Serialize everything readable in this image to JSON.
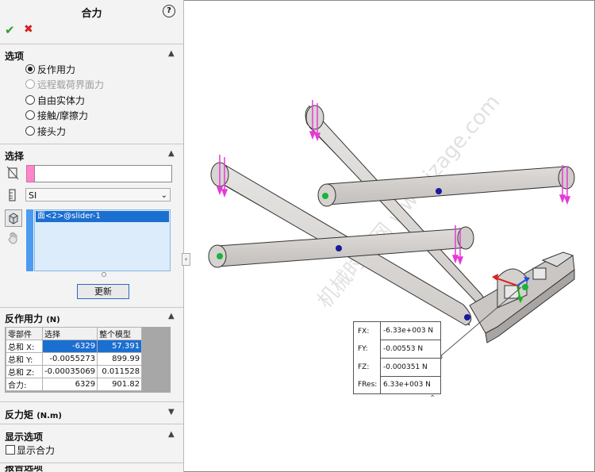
{
  "manager": {
    "title": "合力",
    "help_icon": "?",
    "ok_icon": "✔",
    "cancel_icon": "✖"
  },
  "options": {
    "title": "选项",
    "items": [
      {
        "label": "反作用力",
        "selected": true,
        "enabled": true
      },
      {
        "label": "远程载荷界面力",
        "selected": false,
        "enabled": false
      },
      {
        "label": "自由实体力",
        "selected": false,
        "enabled": true
      },
      {
        "label": "接触/摩擦力",
        "selected": false,
        "enabled": true
      },
      {
        "label": "接头力",
        "selected": false,
        "enabled": true
      }
    ]
  },
  "selection": {
    "title": "选择",
    "input_value": "",
    "units": "SI",
    "list_item": "面<2>@slider-1",
    "update_label": "更新"
  },
  "reaction_force": {
    "title": "反作用力",
    "unit": "(N)",
    "headers": [
      "零部件",
      "选择",
      "整个模型"
    ],
    "rows": [
      [
        "总和 X:",
        "-6329",
        "57.391"
      ],
      [
        "总和 Y:",
        "-0.0055273",
        "899.99"
      ],
      [
        "总和 Z:",
        "-0.00035069",
        "0.011528"
      ],
      [
        "合力:",
        "6329",
        "901.82"
      ]
    ]
  },
  "reaction_moment": {
    "title": "反力矩",
    "unit": "(N.m)"
  },
  "display_options": {
    "title": "显示选项",
    "show_resultant_label": "显示合力",
    "checked": false
  },
  "next_section_partial": "报告选项",
  "callout": {
    "labels": [
      "FX:",
      "FY:",
      "FZ:",
      "FRes:"
    ],
    "values": [
      "-6.33e+003 N",
      "-0.00553 N",
      "-0.000351 N",
      "6.33e+003 N"
    ]
  },
  "watermark": "机械时代网 www.jzage.com",
  "colors": {
    "accent_blue": "#1b6fd0",
    "force_arrow": "#e63ad6",
    "part_fill": "#d3d0cd"
  }
}
